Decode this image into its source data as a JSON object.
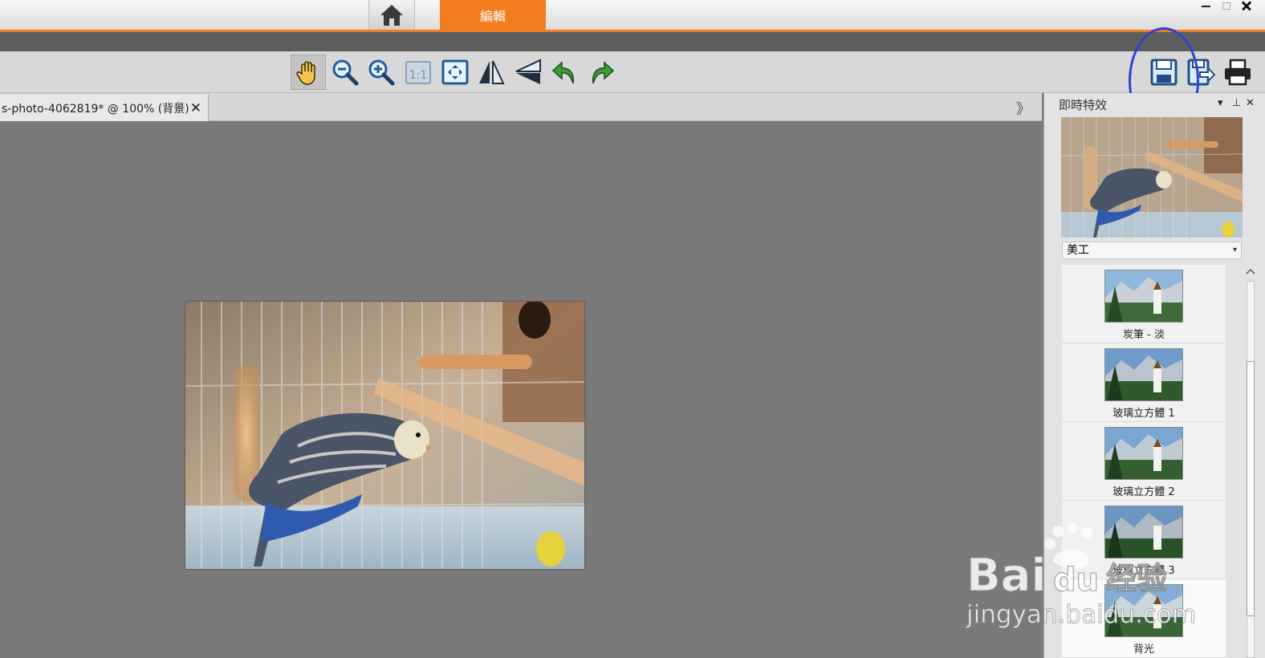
{
  "titlebar": {
    "home_icon": "house-icon",
    "edit_tab_label": "編輯",
    "window_controls": [
      "minimize-icon",
      "restore-icon",
      "close-icon"
    ],
    "accent_color": "#f47c20"
  },
  "toolbar": {
    "tools": [
      {
        "name": "pan",
        "icon": "hand-icon",
        "active": true
      },
      {
        "name": "zoom-out",
        "icon": "zoom-out-icon"
      },
      {
        "name": "zoom-in",
        "icon": "zoom-in-icon"
      },
      {
        "name": "actual-size",
        "icon": "actual-size-icon",
        "label": "1:1"
      },
      {
        "name": "fit-to-window",
        "icon": "fit-window-icon"
      },
      {
        "name": "flip-horizontal",
        "icon": "flip-horizontal-icon"
      },
      {
        "name": "flip-vertical",
        "icon": "flip-vertical-icon"
      },
      {
        "name": "rotate-left",
        "icon": "rotate-left-icon"
      },
      {
        "name": "rotate-right",
        "icon": "rotate-right-icon"
      }
    ],
    "actions": [
      {
        "name": "save",
        "icon": "save-icon"
      },
      {
        "name": "save-as",
        "icon": "save-as-icon"
      },
      {
        "name": "print",
        "icon": "print-icon"
      }
    ],
    "annotation_color": "#2a44d4"
  },
  "document": {
    "tab_label": "s-photo-4062819* @ 100% (背景)",
    "close_symbol": "✕",
    "expand_symbol": "》"
  },
  "panel": {
    "title": "即時特效",
    "controls": {
      "dropdown": "▾",
      "pin": "⊥",
      "close": "✕"
    },
    "category": "美工",
    "category_arrow": "▾",
    "effects": [
      {
        "label": "炭筆 - 淡"
      },
      {
        "label": "玻璃立方體 1"
      },
      {
        "label": "玻璃立方體 2"
      },
      {
        "label": "玻璃立方體 3"
      },
      {
        "label": "背光"
      }
    ]
  },
  "watermark": {
    "line1": "Bai",
    "line2": "jingyan.baidu.com",
    "logo_text": "du",
    "suffix": "经验"
  }
}
